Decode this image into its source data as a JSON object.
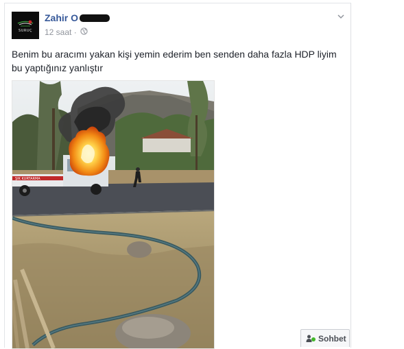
{
  "post": {
    "author": "Zahir O",
    "timestamp": "12 saat",
    "audience_icon": "globe-icon",
    "avatar_logo_text": "SURUÇ",
    "text_line1": "Benim bu aracımı yakan kişi yemin ederim ben senden daha fazla HDP liyim",
    "text_line2": "bu yaptığınız yanlıştır",
    "options_icon": "chevron-down-icon"
  },
  "photo": {
    "truck_sign_text": "ŞIK KURTARMA"
  },
  "chat": {
    "label": "Sohbet",
    "status_color": "#42b72a"
  },
  "colors": {
    "author_link": "#365899",
    "meta_text": "#90949c",
    "body_text": "#1d2129"
  }
}
